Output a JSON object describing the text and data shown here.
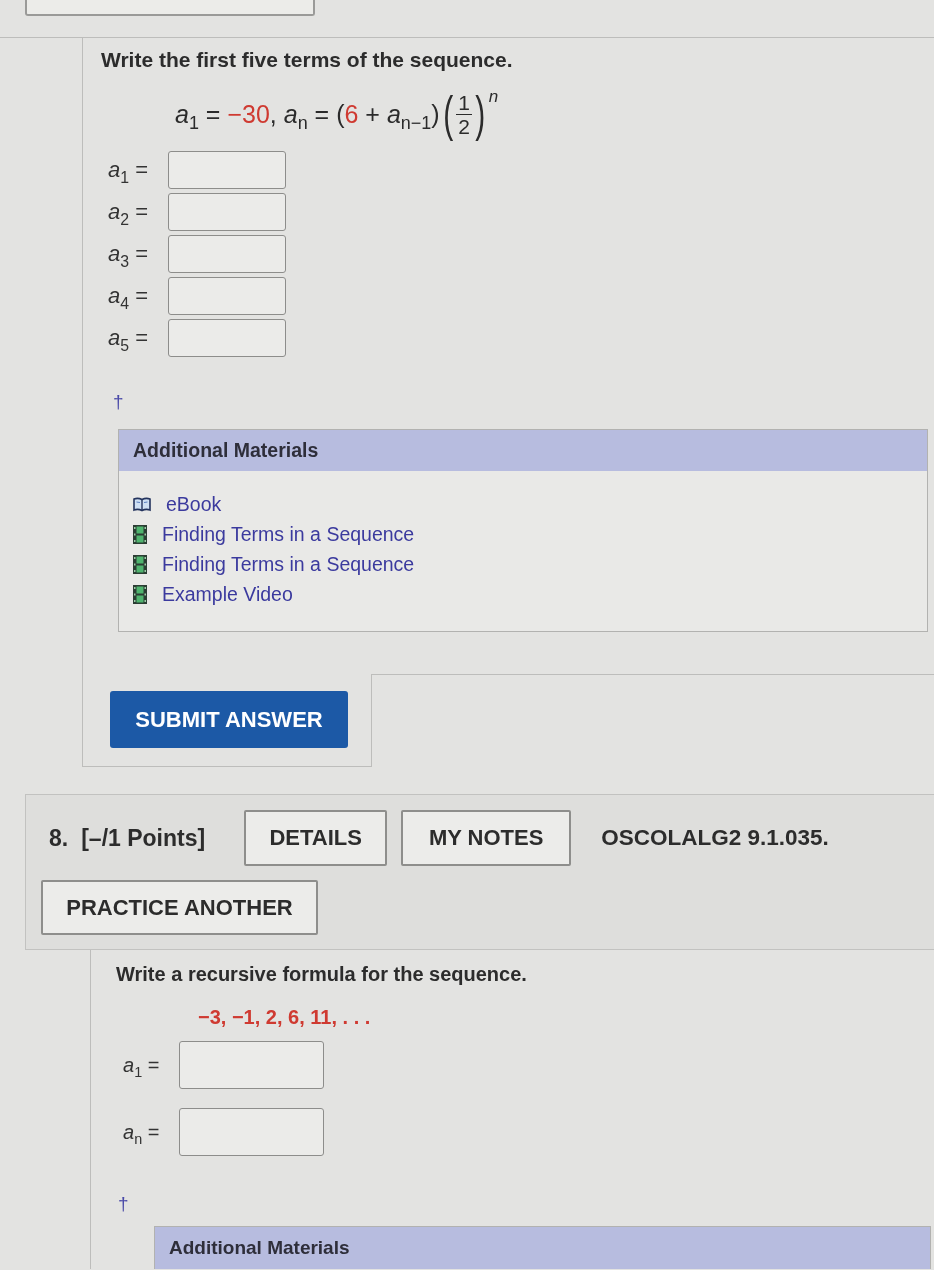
{
  "question_7": {
    "prompt": "Write the first five terms of the sequence.",
    "formula": [
      {
        "kind": "text",
        "text": "*a*$_{1}$ = "
      },
      {
        "kind": "given",
        "text": "−30"
      },
      {
        "kind": "text",
        "text": ", *a*$_{n}$ = ("
      },
      {
        "kind": "given",
        "text": "6"
      },
      {
        "kind": "text",
        "text": " + *a*$_{n−1}$)"
      },
      {
        "kind": "fraction",
        "left": "(",
        "numerator": "1",
        "denominator": "2",
        "right": ")",
        "exponent": "n"
      }
    ],
    "answers": [
      {
        "label": "*a*$_{1}$ ="
      },
      {
        "label": "*a*$_{2}$ ="
      },
      {
        "label": "*a*$_{3}$ ="
      },
      {
        "label": "*a*$_{4}$ ="
      },
      {
        "label": "*a*$_{5}$ ="
      }
    ],
    "footnote_mark": "†",
    "additional_materials": {
      "title": "Additional Materials",
      "links": [
        {
          "kind": "ebook",
          "label": "eBook"
        },
        {
          "kind": "video",
          "label": "Finding Terms in a Sequence"
        },
        {
          "kind": "video",
          "label": "Finding Terms in a Sequence"
        },
        {
          "kind": "video",
          "label": "Example Video"
        }
      ]
    },
    "submit_button": "SUBMIT ANSWER"
  },
  "question_8": {
    "number": "8.",
    "points": "[–/1 Points]",
    "buttons": [
      "DETAILS",
      "MY NOTES"
    ],
    "code": "OSCOLALG2 9.1.035.",
    "practice_button": "PRACTICE ANOTHER",
    "prompt": "Write a recursive formula for the sequence.",
    "sequence": "−3, −1, 2, 6, 11, . . .",
    "answers": [
      {
        "label": "*a*$_{1}$ ="
      },
      {
        "label": "*a*$_{n}$ ="
      }
    ],
    "footnote_mark": "†",
    "additional_materials": {
      "title": "Additional Materials"
    }
  }
}
